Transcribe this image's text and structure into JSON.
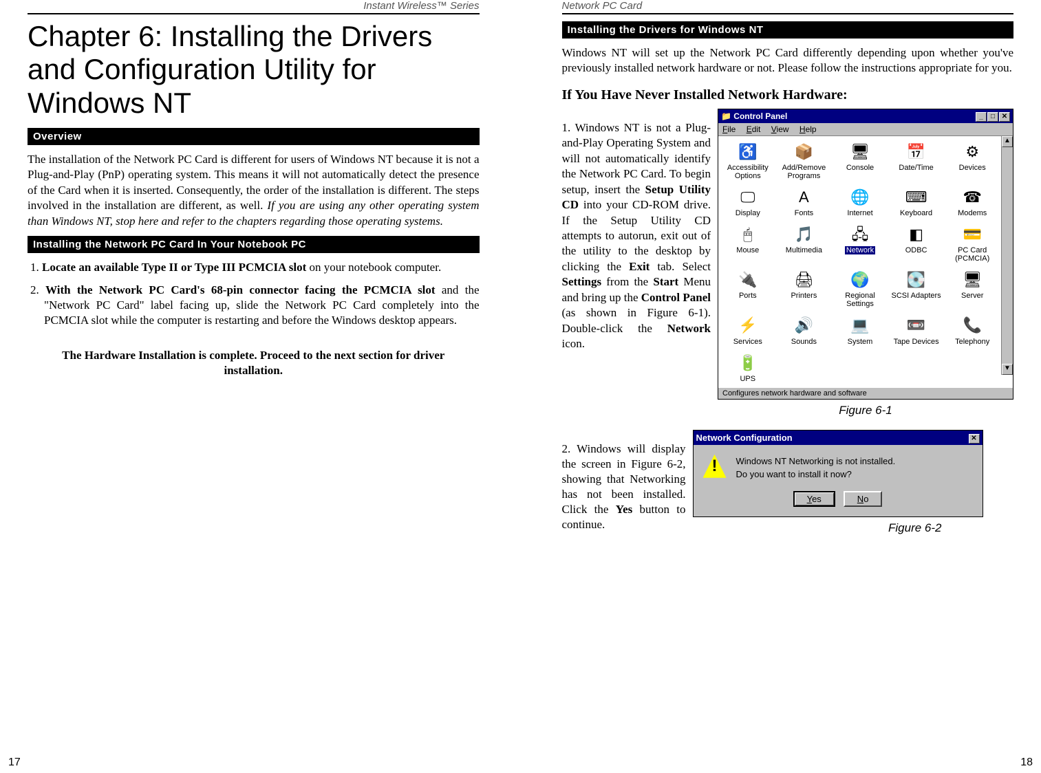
{
  "left": {
    "running_header": "Instant Wireless™ Series",
    "chapter_title": "Chapter 6: Installing the Drivers and Configuration Utility for Windows NT",
    "overview_label": "Overview",
    "overview_para_plain": "The installation of the Network PC Card is different for users of Windows NT because it is not a Plug-and-Play (PnP) operating system. This means it will not automatically detect the presence of the Card when it is inserted. Consequently, the order of the installation is different.  The steps involved in the installation are different, as well.  ",
    "overview_para_italic": "If you are using any other operating system than Windows NT, stop here and refer to the chapters regarding those operating systems.",
    "install_card_label": "Installing the Network PC Card In Your Notebook PC",
    "step1_num": "1. ",
    "step1_bold": "Locate an available Type II or Type III PCMCIA slot",
    "step1_rest": " on your notebook computer.",
    "step2_num": "2. ",
    "step2_bold": "With the Network PC Card's 68-pin connector facing the PCMCIA slot",
    "step2_rest": " and the \"Network PC Card\" label facing up, slide the Network PC Card completely into the PCMCIA slot while the computer is restarting and before the Windows desktop appears.",
    "complete_msg": "The Hardware Installation is complete. Proceed to the next section for driver installation.",
    "page_number": "17"
  },
  "right": {
    "running_header": "Network PC Card",
    "drivers_nt_label": "Installing the Drivers for Windows NT",
    "intro_para": "Windows NT will set up the Network PC Card differently depending upon whether you've previously installed network hardware or not. Please follow the instructions appropriate for you.",
    "subheading": "If You Have Never Installed Network Hardware:",
    "step1_pre": "1. Windows NT is not a Plug-and-Play Operating System and will not automatically identify the Network PC Card. To begin setup, insert the ",
    "step1_b1": "Setup Utility CD",
    "step1_mid1": " into your CD-ROM drive.  If the Setup Utility CD attempts to autorun, exit out of the utility to the desktop by clicking the ",
    "step1_b2": "Exit",
    "step1_mid2": " tab.  Select ",
    "step1_b3": "Settings",
    "step1_mid3": " from the ",
    "step1_b4": "Start",
    "step1_mid4": " Menu and bring up the ",
    "step1_b5": "Control Panel",
    "step1_mid5": " (as shown in Figure 6-1). Double-click the ",
    "step1_b6": "Network",
    "step1_mid6": " icon.",
    "control_panel": {
      "title": "Control Panel",
      "menu": [
        "File",
        "Edit",
        "View",
        "Help"
      ],
      "items": [
        {
          "icon": "♿",
          "label": "Accessibility Options"
        },
        {
          "icon": "📦",
          "label": "Add/Remove Programs"
        },
        {
          "icon": "🖥",
          "label": "Console"
        },
        {
          "icon": "📅",
          "label": "Date/Time"
        },
        {
          "icon": "⚙",
          "label": "Devices"
        },
        {
          "icon": "🖵",
          "label": "Display"
        },
        {
          "icon": "A",
          "label": "Fonts"
        },
        {
          "icon": "🌐",
          "label": "Internet"
        },
        {
          "icon": "⌨",
          "label": "Keyboard"
        },
        {
          "icon": "☎",
          "label": "Modems"
        },
        {
          "icon": "🖱",
          "label": "Mouse"
        },
        {
          "icon": "🎵",
          "label": "Multimedia"
        },
        {
          "icon": "🖧",
          "label": "Network",
          "selected": true
        },
        {
          "icon": "◧",
          "label": "ODBC"
        },
        {
          "icon": "💳",
          "label": "PC Card (PCMCIA)"
        },
        {
          "icon": "🔌",
          "label": "Ports"
        },
        {
          "icon": "🖨",
          "label": "Printers"
        },
        {
          "icon": "🌍",
          "label": "Regional Settings"
        },
        {
          "icon": "💽",
          "label": "SCSI Adapters"
        },
        {
          "icon": "🖥",
          "label": "Server"
        },
        {
          "icon": "⚡",
          "label": "Services"
        },
        {
          "icon": "🔊",
          "label": "Sounds"
        },
        {
          "icon": "💻",
          "label": "System"
        },
        {
          "icon": "📼",
          "label": "Tape Devices"
        },
        {
          "icon": "📞",
          "label": "Telephony"
        },
        {
          "icon": "🔋",
          "label": "UPS"
        }
      ],
      "status": "Configures network hardware and software"
    },
    "fig61_caption": "Figure 6-1",
    "step2_num": "2. ",
    "step2_text_pre": "Windows will display the screen in Figure 6-2, showing that Networking has not been installed. Click the ",
    "step2_text_bold": "Yes",
    "step2_text_post": " button to continue.",
    "dialog": {
      "title": "Network Configuration",
      "line1": "Windows NT Networking is not installed.",
      "line2": "Do you want to install it now?",
      "yes": "Yes",
      "no": "No"
    },
    "fig62_caption": "Figure 6-2",
    "page_number": "18"
  }
}
